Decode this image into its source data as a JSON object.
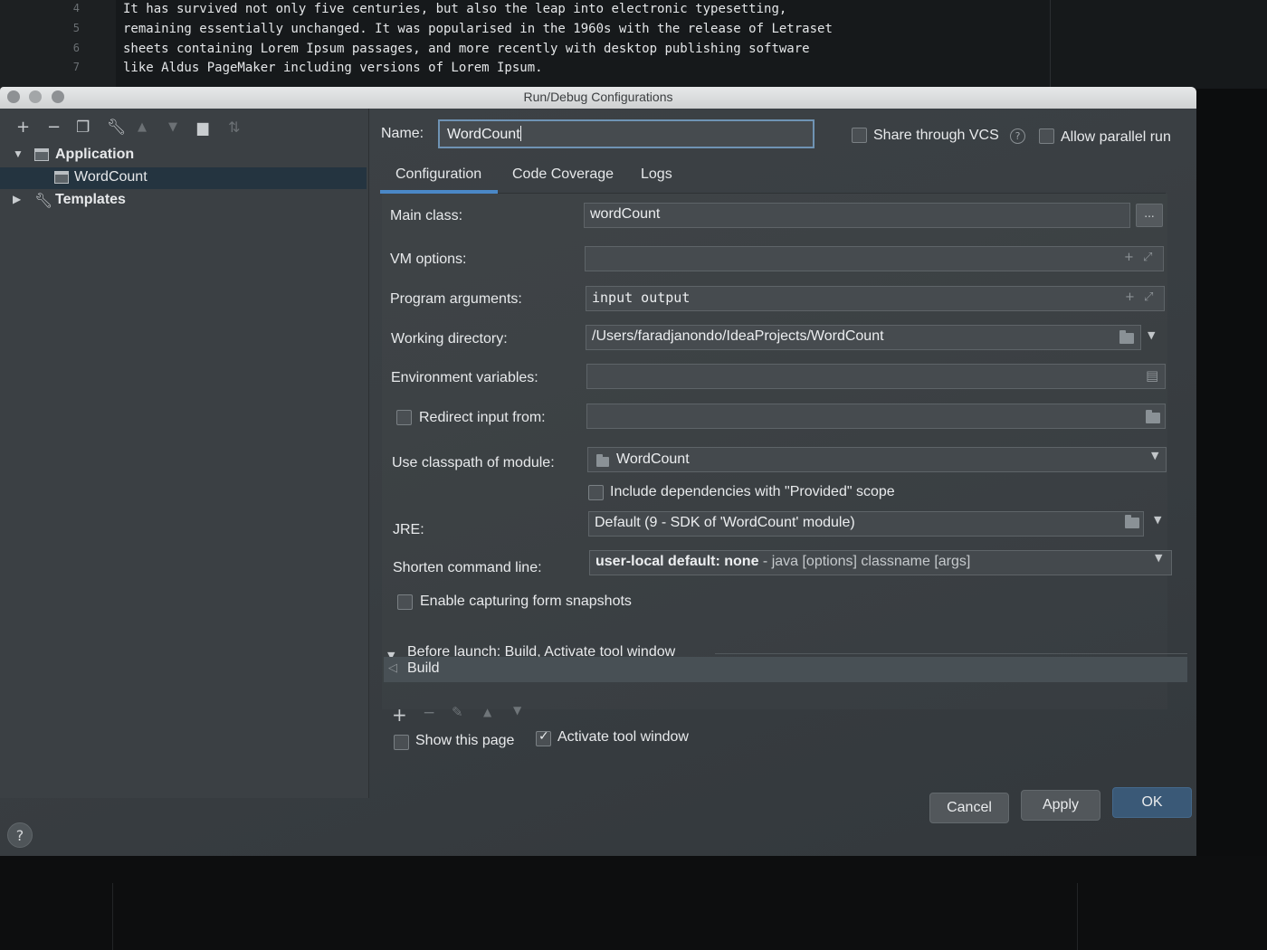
{
  "editor": {
    "lines": [
      {
        "num": "4",
        "text": "It has survived not only five centuries, but also the leap into electronic typesetting,"
      },
      {
        "num": "5",
        "text": "remaining essentially unchanged. It was popularised in the 1960s with the release of Letraset"
      },
      {
        "num": "6",
        "text": "sheets containing Lorem Ipsum passages, and more recently with desktop publishing software"
      },
      {
        "num": "7",
        "text": "like Aldus PageMaker including versions of Lorem Ipsum."
      }
    ]
  },
  "dialog": {
    "title": "Run/Debug Configurations",
    "toolbar_icons": [
      "add-icon",
      "remove-icon",
      "copy-icon",
      "wrench-icon",
      "move-up-icon",
      "move-down-icon",
      "folder-icon",
      "sort-icon"
    ],
    "tree": {
      "application": "Application",
      "wordcount": "WordCount",
      "templates": "Templates"
    },
    "name_label": "Name:",
    "name_value": "WordCount",
    "share_vcs": "Share through VCS",
    "allow_parallel": "Allow parallel run",
    "tabs": [
      "Configuration",
      "Code Coverage",
      "Logs"
    ],
    "active_tab": "Configuration",
    "form": {
      "main_class_label": "Main class:",
      "main_class_value": "wordCount",
      "vm_options_label": "VM options:",
      "vm_options_value": "",
      "program_args_label": "Program arguments:",
      "program_args_value": "input output",
      "working_dir_label": "Working directory:",
      "working_dir_value": "/Users/faradjanondo/IdeaProjects/WordCount",
      "env_vars_label": "Environment variables:",
      "env_vars_value": "",
      "redirect_label": "Redirect input from:",
      "redirect_checked": false,
      "classpath_label": "Use classpath of module:",
      "classpath_value": "WordCount",
      "include_deps_label": "Include dependencies with \"Provided\" scope",
      "include_deps_checked": false,
      "jre_label": "JRE:",
      "jre_value": "Default (9 - SDK of 'WordCount' module)",
      "shorten_label": "Shorten command line:",
      "shorten_value_bold": "user-local default: none",
      "shorten_value_rest": " - java [options] classname [args]",
      "snapshots_label": "Enable capturing form snapshots",
      "snapshots_checked": false
    },
    "before_launch": {
      "header": "Before launch: Build, Activate tool window",
      "items": [
        "Build"
      ],
      "show_page_label": "Show this page",
      "show_page_checked": false,
      "activate_label": "Activate tool window",
      "activate_checked": true
    },
    "buttons": {
      "cancel": "Cancel",
      "apply": "Apply",
      "ok": "OK"
    },
    "help": "?"
  },
  "colors": {
    "selection": "#243440",
    "tab_underline": "#4a88c7",
    "focus_border": "#6f93b4"
  }
}
